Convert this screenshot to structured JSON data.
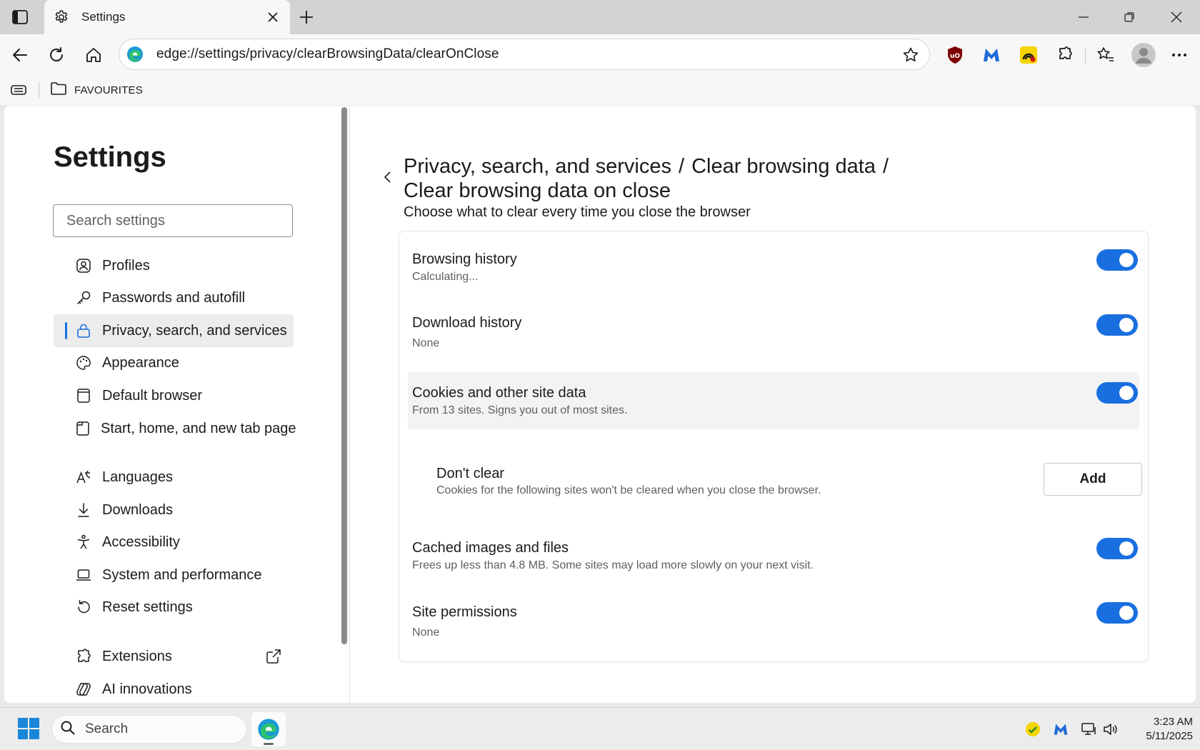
{
  "browser": {
    "tab_title": "Settings",
    "url": "edge://settings/privacy/clearBrowsingData/clearOnClose",
    "favourites_folder": "FAVOURITES"
  },
  "sidebar": {
    "title": "Settings",
    "search_placeholder": "Search settings",
    "items": [
      {
        "label": "Profiles",
        "icon": "profile-icon"
      },
      {
        "label": "Passwords and autofill",
        "icon": "key-icon"
      },
      {
        "label": "Privacy, search, and services",
        "icon": "lock-icon",
        "active": true
      },
      {
        "label": "Appearance",
        "icon": "palette-icon"
      },
      {
        "label": "Default browser",
        "icon": "browser-icon"
      },
      {
        "label": "Start, home, and new tab page",
        "icon": "home-tab-icon"
      },
      {
        "label": "Languages",
        "icon": "languages-icon"
      },
      {
        "label": "Downloads",
        "icon": "download-icon"
      },
      {
        "label": "Accessibility",
        "icon": "accessibility-icon"
      },
      {
        "label": "System and performance",
        "icon": "laptop-icon"
      },
      {
        "label": "Reset settings",
        "icon": "reset-icon"
      },
      {
        "label": "Extensions",
        "icon": "puzzle-icon"
      },
      {
        "label": "AI innovations",
        "icon": "ai-icon"
      }
    ]
  },
  "main": {
    "breadcrumb": {
      "crumb1": "Privacy, search, and services",
      "crumb2": "Clear browsing data",
      "crumb3": "Clear browsing data on close",
      "separator": "/"
    },
    "subtitle": "Choose what to clear every time you close the browser",
    "rows": {
      "browsing_history": {
        "title": "Browsing history",
        "desc": "Calculating...",
        "on": true
      },
      "download_history": {
        "title": "Download history",
        "desc": "None",
        "on": true
      },
      "cookies": {
        "title": "Cookies and other site data",
        "desc": "From 13 sites. Signs you out of most sites.",
        "on": true
      },
      "dont_clear": {
        "title": "Don't clear",
        "desc": "Cookies for the following sites won't be cleared when you close the browser.",
        "button": "Add"
      },
      "cached": {
        "title": "Cached images and files",
        "desc": "Frees up less than 4.8 MB. Some sites may load more slowly on your next visit.",
        "on": true
      },
      "site_permissions": {
        "title": "Site permissions",
        "desc": "None",
        "on": true
      }
    }
  },
  "taskbar": {
    "search_label": "Search",
    "time": "3:23 AM",
    "date": "5/11/2025"
  },
  "colors": {
    "accent": "#1a6fe0",
    "titlebar": "#d3d3d3",
    "toolbar": "#f7f7f7"
  }
}
